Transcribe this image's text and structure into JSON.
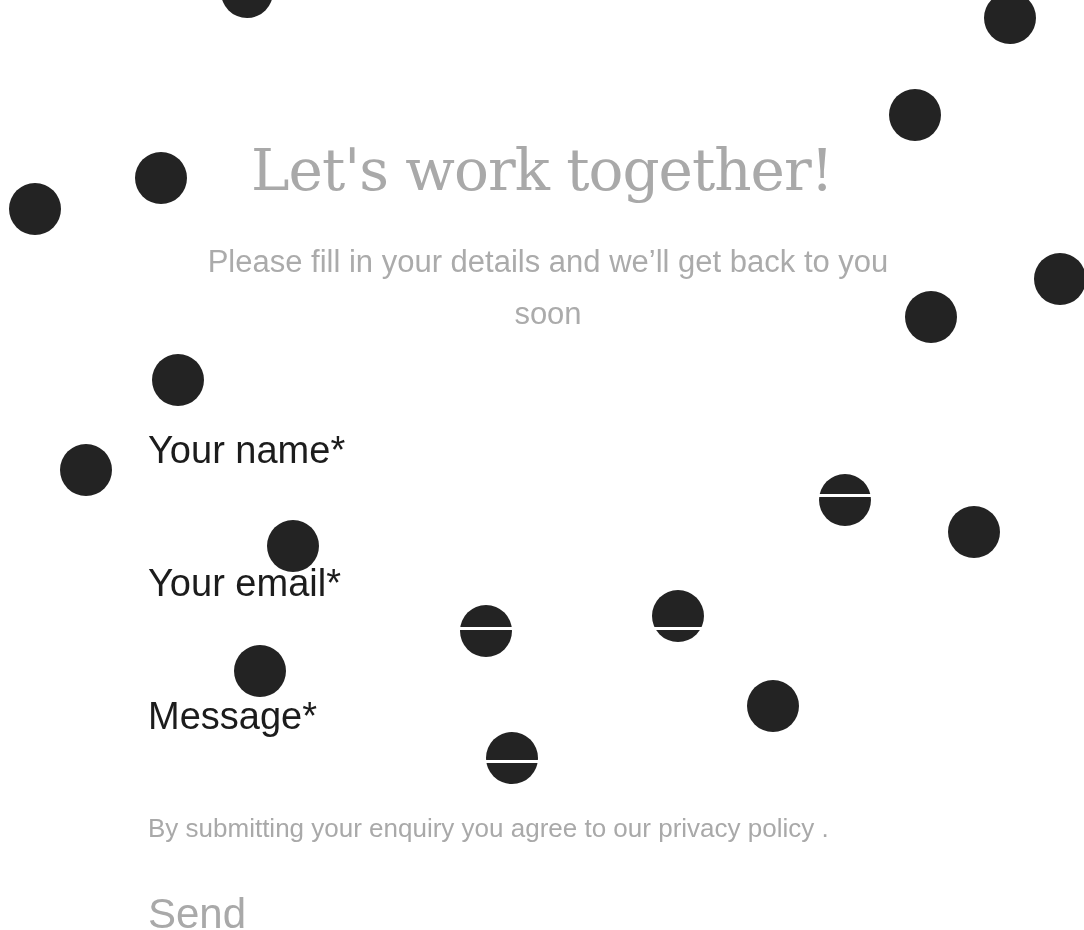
{
  "heading": "Let's work together!",
  "subheading": "Please fill in your details and we’ll get back to you soon",
  "fields": [
    {
      "label": "Your name*"
    },
    {
      "label": "Your email*"
    },
    {
      "label": "Message*"
    }
  ],
  "consent": {
    "text": "By submitting your enquiry you agree to our ",
    "link": "privacy policy",
    "end": " ."
  },
  "submit": "Send"
}
